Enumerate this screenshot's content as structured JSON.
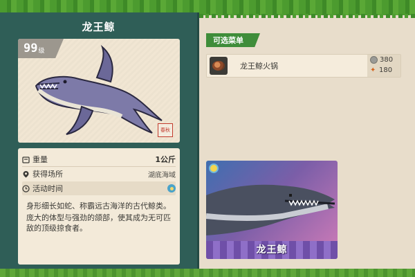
{
  "creature": {
    "name": "龙王鲸",
    "level": "99",
    "level_unit": "级",
    "seal_text": "春秋"
  },
  "info": {
    "weight_label": "重量",
    "weight_value": "1公斤",
    "location_label": "获得场所",
    "location_value": "湖底海域",
    "time_label": "活动时间",
    "time_icon": "sun-icon"
  },
  "description": [
    "身形细长如蛇、称霸远古海洋的古代鲸类。",
    "庞大的体型与强劲的颌部，使其成为无可匹敌的顶级掠食者。"
  ],
  "menu": {
    "tag_label": "可选菜单",
    "dishes": [
      {
        "name": "龙王鲸火锅",
        "price": "380",
        "production": "180"
      }
    ]
  },
  "card": {
    "name": "龙王鲸"
  },
  "colors": {
    "panel": "#2f5e57",
    "grass": "#4c9b2f",
    "tag": "#3f8d3a",
    "paper": "#f3ead9"
  }
}
